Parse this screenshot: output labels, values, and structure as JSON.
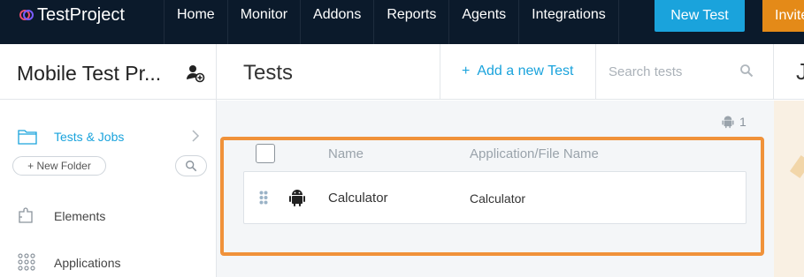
{
  "topbar": {
    "logo_text": "TestProject",
    "nav": [
      "Home",
      "Monitor",
      "Addons",
      "Reports",
      "Agents",
      "Integrations"
    ],
    "new_test_label": "New Test",
    "invite_label": "Invite",
    "colors": {
      "bg": "#0b1a2b",
      "primary": "#1aa3dc",
      "invite": "#e48a18"
    }
  },
  "header": {
    "project_title": "Mobile Test Pr...",
    "page_title": "Tests",
    "add_test_label": "Add a new Test",
    "search_placeholder": "Search tests",
    "next_panel_letter": "J"
  },
  "sidebar": {
    "tests_jobs_label": "Tests & Jobs",
    "new_folder_label": "+ New Folder",
    "elements_label": "Elements",
    "applications_label": "Applications"
  },
  "tests_list": {
    "platform_count": "1",
    "columns": {
      "name": "Name",
      "app": "Application/File Name"
    },
    "rows": [
      {
        "platform": "android-icon",
        "name": "Calculator",
        "app": "Calculator"
      }
    ],
    "highlight_color": "#f0923a"
  }
}
